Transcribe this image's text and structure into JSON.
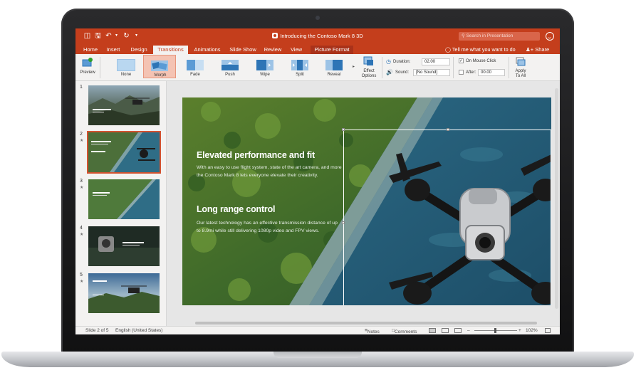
{
  "window": {
    "title": "Introducing the Contoso Mark 8 3D",
    "search_placeholder": "Search in Presentation"
  },
  "tabs": [
    "Home",
    "Insert",
    "Design",
    "Transitions",
    "Animations",
    "Slide Show",
    "Review",
    "View",
    "Picture Format"
  ],
  "active_tab": "Transitions",
  "tell_me": "Tell me what you want to do",
  "share_label": "Share",
  "ribbon": {
    "preview_label": "Preview",
    "transitions": [
      "None",
      "Morph",
      "Fade",
      "Push",
      "Wipe",
      "Split",
      "Reveal"
    ],
    "selected_transition": "Morph",
    "effect_options_line1": "Effect",
    "effect_options_line2": "Options",
    "duration_label": "Duration:",
    "duration_value": "02.00",
    "sound_label": "Sound:",
    "sound_value": "[No Sound]",
    "on_mouse_click_label": "On Mouse Click",
    "on_mouse_click_checked": true,
    "after_label": "After:",
    "after_value": "00.00",
    "apply_all_line1": "Apply",
    "apply_all_line2": "To All"
  },
  "slides": [
    {
      "number": "1",
      "title": "Contoso Mark 8",
      "subtitle": "Creativity unleashed"
    },
    {
      "number": "2",
      "heading": "Elevated performance and fit"
    },
    {
      "number": "3"
    },
    {
      "number": "4"
    },
    {
      "number": "5"
    }
  ],
  "selected_slide": "2",
  "slide": {
    "heading1": "Elevated performance and fit",
    "body1_line1": "With an easy to use flight system, state of the art camera, and more",
    "body1_line2": "the Contoso Mark 8 lets everyone elevate their creativity.",
    "heading2": "Long range control",
    "body2_line1": "Our latest technology has an effective transmission distance of up",
    "body2_line2": "to 8.9mi while still delivering 1080p video and FPV views."
  },
  "status": {
    "slide_info": "Slide 2 of 5",
    "language": "English (United States)",
    "notes": "Notes",
    "comments": "Comments",
    "zoom": "102%"
  },
  "colors": {
    "accent": "#c43e1c",
    "selected": "#f4c3b3"
  }
}
